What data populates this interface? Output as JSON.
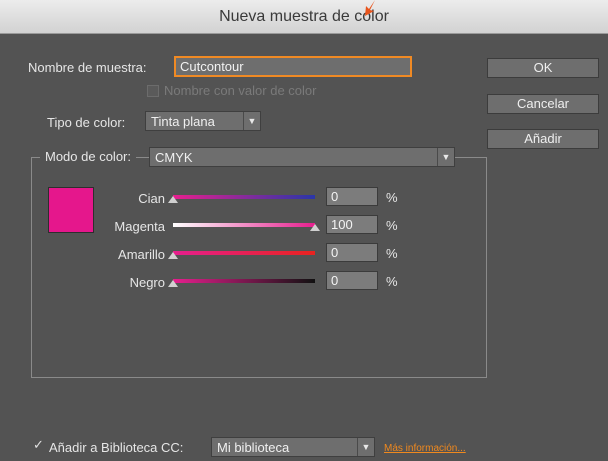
{
  "window": {
    "title": "Nueva muestra de color"
  },
  "name": {
    "label": "Nombre de muestra:",
    "value": "Cutcontour"
  },
  "name_with_value": {
    "label": "Nombre con valor de color",
    "checked": false
  },
  "color_type": {
    "label": "Tipo de color:",
    "value": "Tinta plana"
  },
  "color_mode": {
    "label": "Modo de color:",
    "value": "CMYK"
  },
  "swatch_color": "#e5178c",
  "buttons": {
    "ok": "OK",
    "cancel": "Cancelar",
    "add": "Añadir"
  },
  "channels": [
    {
      "label": "Cian",
      "value": "0",
      "unit": "%",
      "fraction": 0.0,
      "gradient": [
        "#e61f8e",
        "#2a36a8"
      ]
    },
    {
      "label": "Magenta",
      "value": "100",
      "unit": "%",
      "fraction": 1.0,
      "gradient": [
        "#ffffff",
        "#e61f8e"
      ]
    },
    {
      "label": "Amarillo",
      "value": "0",
      "unit": "%",
      "fraction": 0.0,
      "gradient": [
        "#e61f8e",
        "#e8231f"
      ]
    },
    {
      "label": "Negro",
      "value": "0",
      "unit": "%",
      "fraction": 0.0,
      "gradient": [
        "#e61f8e",
        "#111111"
      ]
    }
  ],
  "footer": {
    "cc_label": "Añadir a Biblioteca CC:",
    "cc_checked": true,
    "library": "Mi biblioteca",
    "more_info": "Más información..."
  },
  "colors": {
    "accent": "#f08a24",
    "dialog_bg": "#535353"
  }
}
